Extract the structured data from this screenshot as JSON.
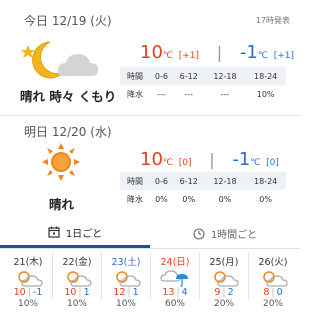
{
  "today": {
    "date": "今日 12/19 (火)",
    "source": "17時発表",
    "condition": "晴れ 時々 くもり",
    "high": "10",
    "high_unit": "℃",
    "high_diff": "[+1]",
    "low": "-1",
    "low_unit": "℃",
    "low_diff": "[+1]",
    "row_label_time": "時間",
    "row_label_rain": "降水",
    "periods": [
      "0-6",
      "6-12",
      "12-18",
      "18-24"
    ],
    "rain": [
      "---",
      "---",
      "---",
      "10%"
    ]
  },
  "tomorrow": {
    "date": "明日 12/20 (水)",
    "condition": "晴れ",
    "high": "10",
    "high_unit": "℃",
    "high_diff": "[0]",
    "low": "-1",
    "low_unit": "℃",
    "low_diff": "[0]",
    "row_label_time": "時間",
    "row_label_rain": "降水",
    "periods": [
      "0-6",
      "6-12",
      "12-18",
      "18-24"
    ],
    "rain": [
      "0%",
      "0%",
      "0%",
      "0%"
    ]
  },
  "tabs": {
    "daily": "1日ごと",
    "hourly": "1時間ごと"
  },
  "week": [
    {
      "name": "21(木)",
      "icon": "sun-cloud",
      "hi": "10",
      "lo": "-1",
      "pop": "10%",
      "kind": "weekday"
    },
    {
      "name": "22(金)",
      "icon": "sun-cloud",
      "hi": "10",
      "lo": "1",
      "pop": "10%",
      "kind": "weekday"
    },
    {
      "name": "23(土)",
      "icon": "sun-cloud",
      "hi": "12",
      "lo": "1",
      "pop": "10%",
      "kind": "sat"
    },
    {
      "name": "24(日)",
      "icon": "cloud-umbrella",
      "hi": "13",
      "lo": "4",
      "pop": "60%",
      "kind": "sun"
    },
    {
      "name": "25(月)",
      "icon": "sun-cloud",
      "hi": "9",
      "lo": "2",
      "pop": "20%",
      "kind": "weekday"
    },
    {
      "name": "26(火)",
      "icon": "sun-cloud",
      "hi": "8",
      "lo": "0",
      "pop": "20%",
      "kind": "weekday"
    }
  ],
  "colors": {
    "high": "#e8401c",
    "low": "#2d6bc9",
    "tab_active": "#1a4fa0",
    "table_header_bg": "#eef2f6"
  }
}
